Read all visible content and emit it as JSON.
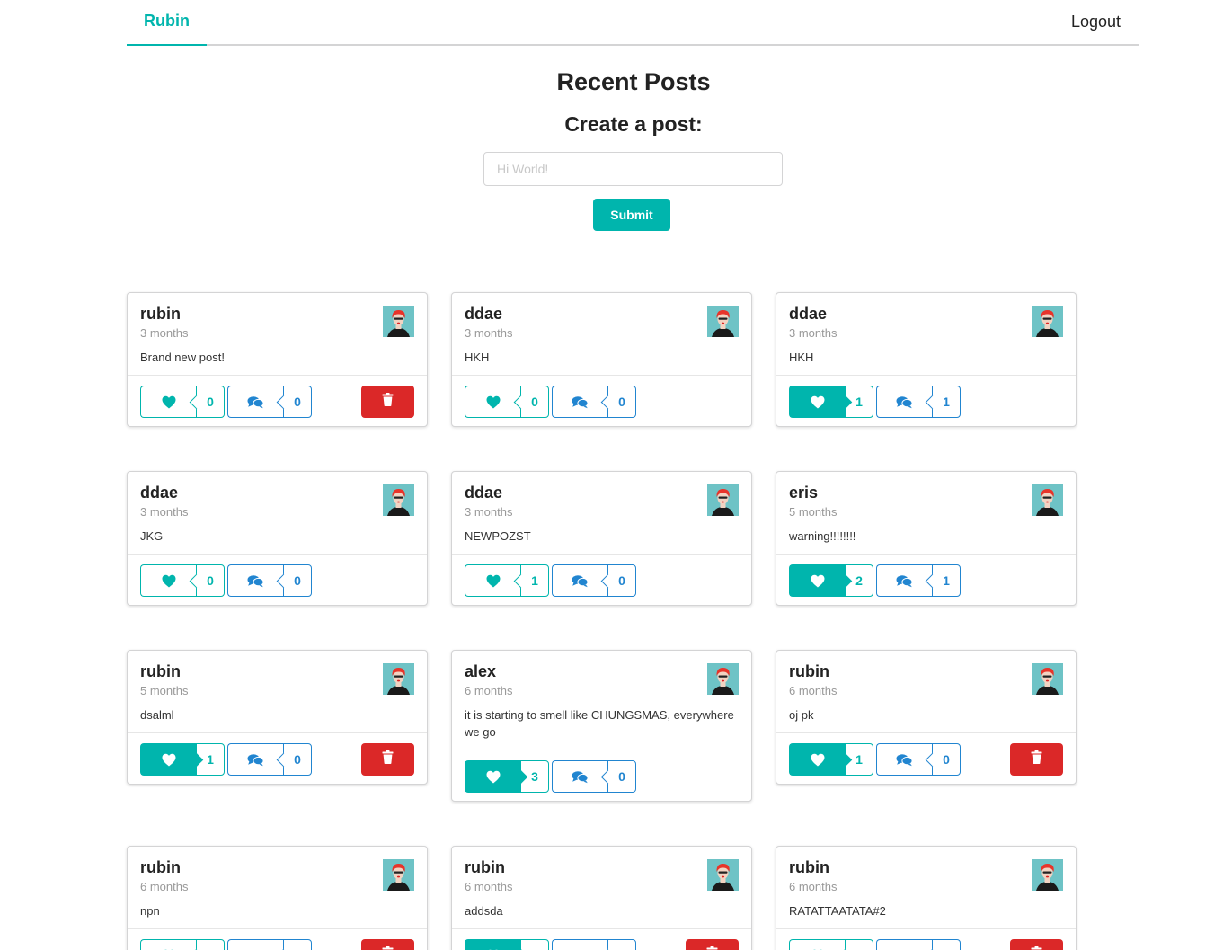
{
  "nav": {
    "brand": "Rubin",
    "logout": "Logout"
  },
  "main": {
    "title": "Recent Posts",
    "create_title": "Create a post:",
    "input_placeholder": "Hi World!",
    "submit_label": "Submit"
  },
  "colors": {
    "teal": "#00b5ad",
    "blue": "#2185d0",
    "red": "#db2828"
  },
  "posts": [
    {
      "author": "rubin",
      "time": "3 months",
      "text": "Brand new post!",
      "likes": "0",
      "comments": "0",
      "liked": false,
      "deletable": true
    },
    {
      "author": "ddae",
      "time": "3 months",
      "text": "HKH",
      "likes": "0",
      "comments": "0",
      "liked": false,
      "deletable": false
    },
    {
      "author": "ddae",
      "time": "3 months",
      "text": "HKH",
      "likes": "1",
      "comments": "1",
      "liked": true,
      "deletable": false
    },
    {
      "author": "ddae",
      "time": "3 months",
      "text": "JKG",
      "likes": "0",
      "comments": "0",
      "liked": false,
      "deletable": false
    },
    {
      "author": "ddae",
      "time": "3 months",
      "text": "NEWPOZST",
      "likes": "1",
      "comments": "0",
      "liked": false,
      "deletable": false
    },
    {
      "author": "eris",
      "time": "5 months",
      "text": "warning!!!!!!!!",
      "likes": "2",
      "comments": "1",
      "liked": true,
      "deletable": false
    },
    {
      "author": "rubin",
      "time": "5 months",
      "text": "dsalml",
      "likes": "1",
      "comments": "0",
      "liked": true,
      "deletable": true
    },
    {
      "author": "alex",
      "time": "6 months",
      "text": "it is starting to smell like CHUNGSMAS, everywhere we go",
      "likes": "3",
      "comments": "0",
      "liked": true,
      "deletable": false
    },
    {
      "author": "rubin",
      "time": "6 months",
      "text": "oj pk",
      "likes": "1",
      "comments": "0",
      "liked": true,
      "deletable": true
    },
    {
      "author": "rubin",
      "time": "6 months",
      "text": "npn",
      "likes": "",
      "comments": "",
      "liked": false,
      "deletable": true
    },
    {
      "author": "rubin",
      "time": "6 months",
      "text": "addsda",
      "likes": "",
      "comments": "",
      "liked": true,
      "deletable": true
    },
    {
      "author": "rubin",
      "time": "6 months",
      "text": "RATATTAATATA#2",
      "likes": "",
      "comments": "",
      "liked": false,
      "deletable": true
    }
  ]
}
